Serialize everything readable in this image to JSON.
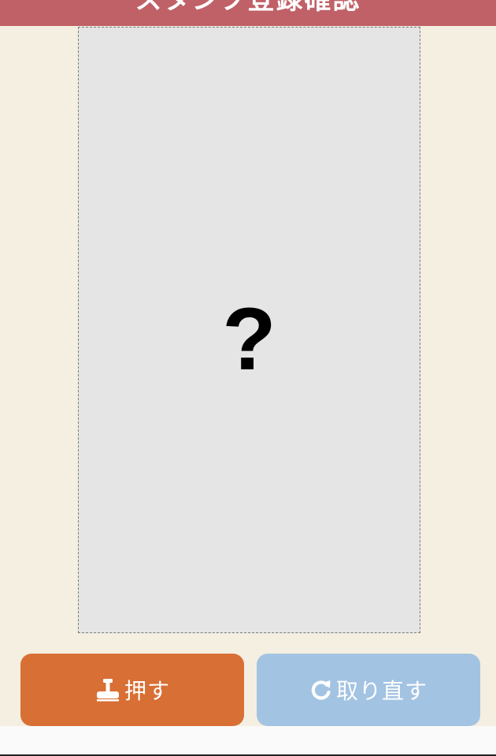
{
  "header": {
    "title": "スタンプ登録確認"
  },
  "stamp_area": {
    "placeholder_symbol": "?"
  },
  "buttons": {
    "push": {
      "label": "押す",
      "icon": "stamp-icon",
      "color": "#d86f34"
    },
    "retake": {
      "label": "取り直す",
      "icon": "refresh-icon",
      "color": "#a3c3e2"
    }
  },
  "colors": {
    "header": "#c06167",
    "background": "#f4efe1",
    "stamp_area": "#e5e5e5"
  }
}
